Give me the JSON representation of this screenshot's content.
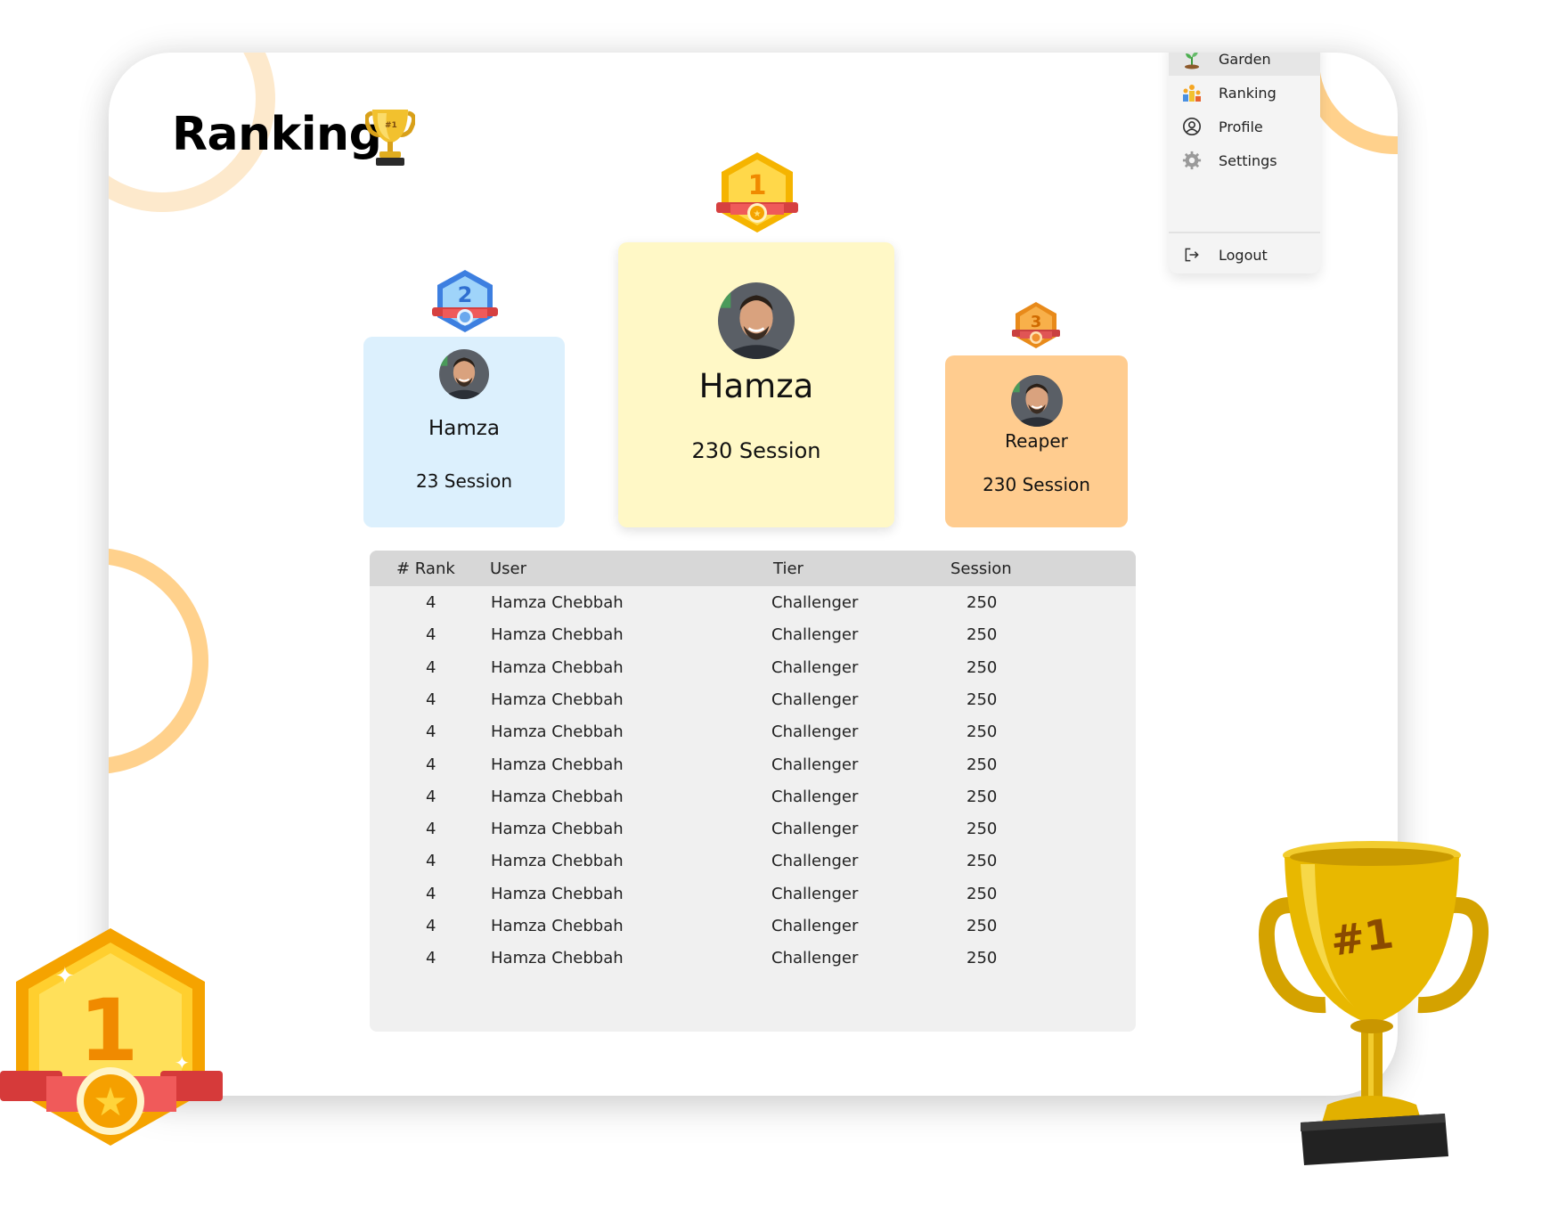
{
  "page": {
    "title": "Ranking"
  },
  "menu": {
    "items": [
      {
        "label": "Garden",
        "icon": "sprout-icon"
      },
      {
        "label": "Ranking",
        "icon": "podium-icon"
      },
      {
        "label": "Profile",
        "icon": "user-circle-icon"
      },
      {
        "label": "Settings",
        "icon": "gear-icon"
      },
      {
        "label": "Logout",
        "icon": "logout-icon"
      }
    ]
  },
  "podium": {
    "first": {
      "rank": "1",
      "name": "Hamza",
      "sessions": "230 Session"
    },
    "second": {
      "rank": "2",
      "name": "Hamza",
      "sessions": "23 Session"
    },
    "third": {
      "rank": "3",
      "name": "Reaper",
      "sessions": "230 Session"
    }
  },
  "table": {
    "headers": {
      "rank": "# Rank",
      "user": "User",
      "tier": "Tier",
      "session": "Session"
    },
    "rows": [
      {
        "rank": "4",
        "user": "Hamza Chebbah",
        "tier": "Challenger",
        "session": "250"
      },
      {
        "rank": "4",
        "user": "Hamza Chebbah",
        "tier": "Challenger",
        "session": "250"
      },
      {
        "rank": "4",
        "user": "Hamza Chebbah",
        "tier": "Challenger",
        "session": "250"
      },
      {
        "rank": "4",
        "user": "Hamza Chebbah",
        "tier": "Challenger",
        "session": "250"
      },
      {
        "rank": "4",
        "user": "Hamza Chebbah",
        "tier": "Challenger",
        "session": "250"
      },
      {
        "rank": "4",
        "user": "Hamza Chebbah",
        "tier": "Challenger",
        "session": "250"
      },
      {
        "rank": "4",
        "user": "Hamza Chebbah",
        "tier": "Challenger",
        "session": "250"
      },
      {
        "rank": "4",
        "user": "Hamza Chebbah",
        "tier": "Challenger",
        "session": "250"
      },
      {
        "rank": "4",
        "user": "Hamza Chebbah",
        "tier": "Challenger",
        "session": "250"
      },
      {
        "rank": "4",
        "user": "Hamza Chebbah",
        "tier": "Challenger",
        "session": "250"
      },
      {
        "rank": "4",
        "user": "Hamza Chebbah",
        "tier": "Challenger",
        "session": "250"
      },
      {
        "rank": "4",
        "user": "Hamza Chebbah",
        "tier": "Challenger",
        "session": "250"
      }
    ]
  },
  "decor": {
    "big_badge_number": "1",
    "trophy_label": "#1"
  },
  "colors": {
    "first_card": "#fff8c6",
    "second_card": "#dcf0fd",
    "third_card": "#ffcc8f",
    "table_header": "#d7d7d7",
    "table_body": "#f0f0f0",
    "accent_ring": "#ffd18c"
  }
}
